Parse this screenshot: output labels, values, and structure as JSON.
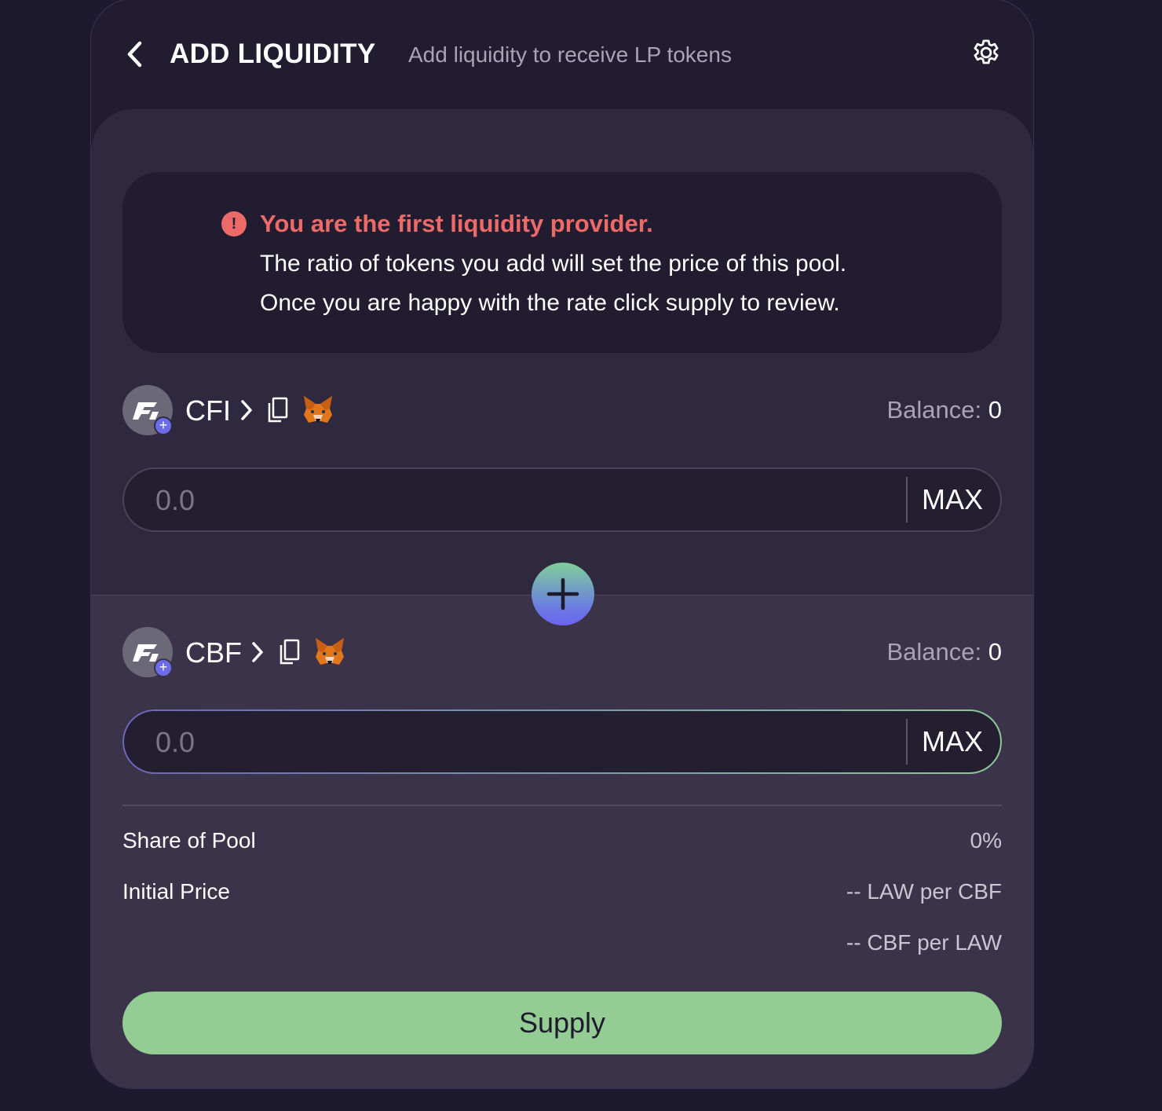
{
  "header": {
    "title": "ADD LIQUIDITY",
    "subtitle": "Add liquidity to receive LP tokens",
    "back_icon": "chevron-left-icon",
    "settings_icon": "gear-icon"
  },
  "notice": {
    "icon": "alert-icon",
    "icon_glyph": "!",
    "title": "You are the first liquidity provider.",
    "line1": "The ratio of tokens you add will set the price of this pool.",
    "line2": "Once you are happy with the rate click supply to review.",
    "accent_color": "#ec6a68"
  },
  "token_a": {
    "symbol": "CFI",
    "balance_label": "Balance:",
    "balance_value": "0",
    "amount_placeholder": "0.0",
    "max_label": "MAX"
  },
  "token_b": {
    "symbol": "CBF",
    "balance_label": "Balance:",
    "balance_value": "0",
    "amount_placeholder": "0.0",
    "max_label": "MAX"
  },
  "pool_info": {
    "share_label": "Share of Pool",
    "share_value": "0%",
    "price_label": "Initial Price",
    "price_value_1": "-- LAW per CBF",
    "price_value_2": "-- CBF per LAW"
  },
  "actions": {
    "supply_label": "Supply",
    "supply_color": "#93cd93"
  },
  "colors": {
    "background": "#1d1a2f",
    "card": "#221c30",
    "panel": "#2f2940"
  }
}
